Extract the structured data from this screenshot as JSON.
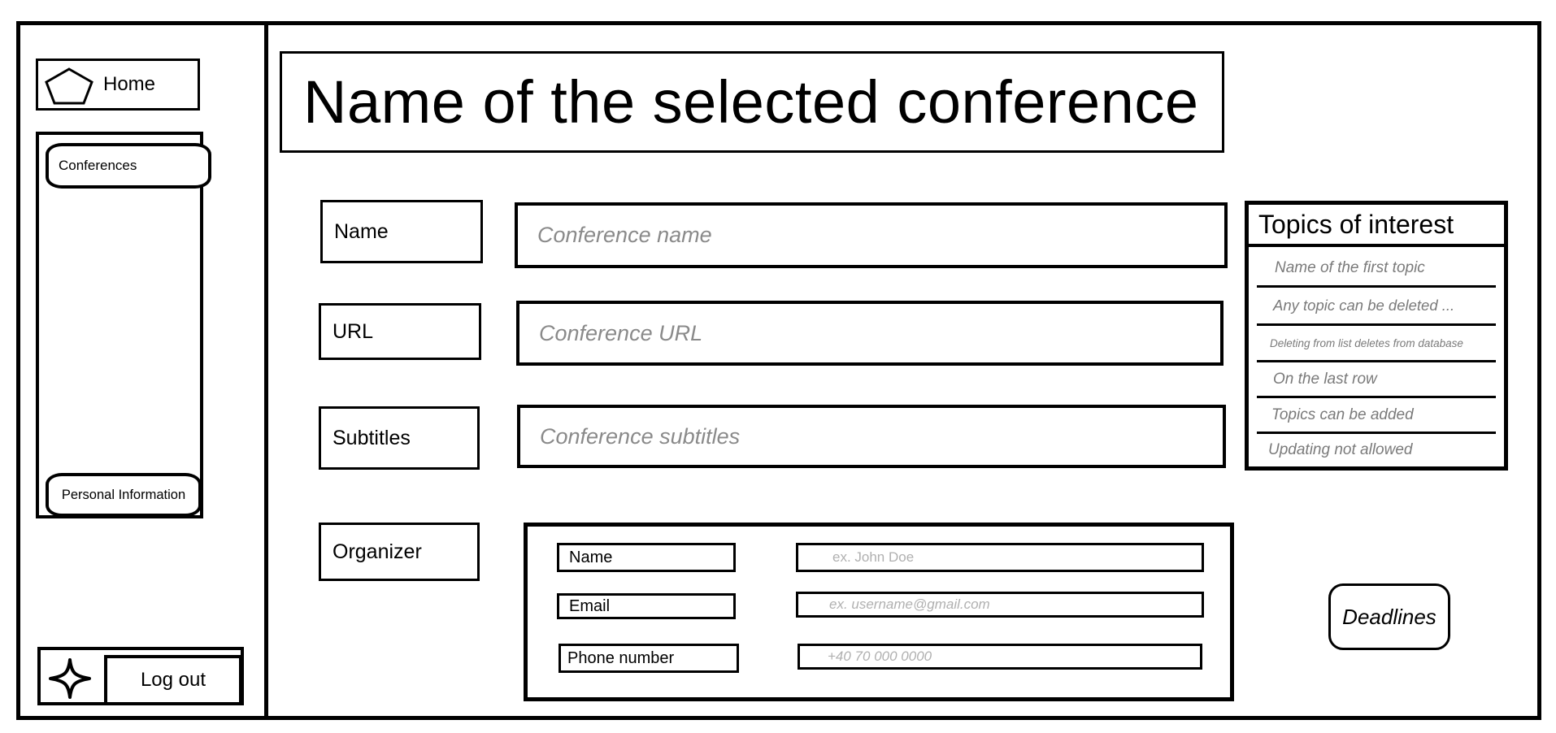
{
  "sidebar": {
    "home_label": "Home",
    "home_icon": "pentagon-icon",
    "nav_items": [
      {
        "label": "Conferences"
      },
      {
        "label": "Personal Information"
      }
    ],
    "logout_label": "Log out",
    "logout_icon": "star-icon"
  },
  "main": {
    "title": "Name of the selected conference",
    "fields": {
      "name": {
        "label": "Name",
        "placeholder": "Conference name"
      },
      "url": {
        "label": "URL",
        "placeholder": "Conference URL"
      },
      "subtitles": {
        "label": "Subtitles",
        "placeholder": "Conference subtitles"
      }
    },
    "organizer": {
      "label": "Organizer",
      "name": {
        "label": "Name",
        "placeholder": "ex. John Doe"
      },
      "email": {
        "label": "Email",
        "placeholder": "ex. username@gmail.com"
      },
      "phone": {
        "label": "Phone number",
        "placeholder": "+40 70 000 0000"
      }
    },
    "topics": {
      "title": "Topics of interest",
      "items": [
        "Name of the first topic",
        "Any topic can be deleted ...",
        "Deleting from list deletes from database",
        "On the last row",
        "Topics can be added",
        "Updating not allowed"
      ]
    },
    "deadlines_label": "Deadlines"
  }
}
